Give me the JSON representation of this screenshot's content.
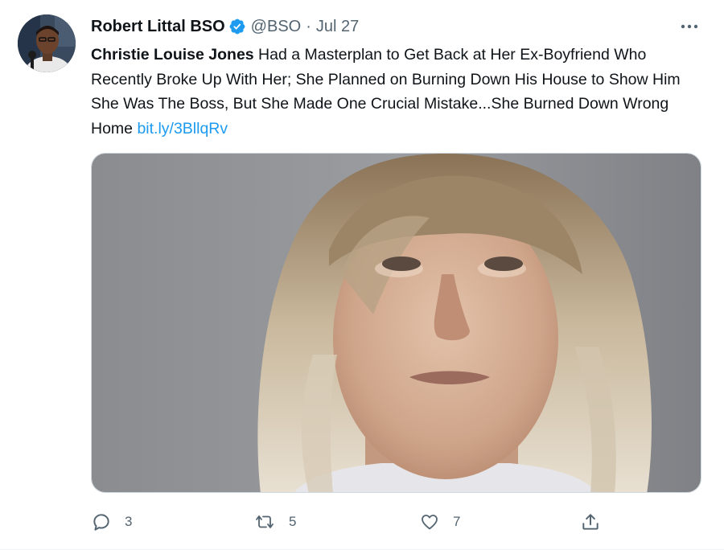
{
  "tweet": {
    "author": {
      "display_name": "Robert Littal BSO",
      "handle": "@BSO",
      "verified": true
    },
    "separator": "·",
    "timestamp": "Jul 27",
    "text": {
      "bold_lead": "Christie Louise Jones",
      "body": " Had a Masterplan to Get Back at Her Ex-Boyfriend Who Recently Broke Up With Her; She Planned on Burning Down His House to Show Him She Was The Boss, But She Made One Crucial Mistake...She Burned Down Wrong Home ",
      "link": "bit.ly/3BllqRv"
    },
    "actions": {
      "reply_count": "3",
      "retweet_count": "5",
      "like_count": "7"
    }
  },
  "icons": {
    "verified": "verified-badge-icon",
    "more": "more-icon",
    "reply": "reply-icon",
    "retweet": "retweet-icon",
    "like": "like-icon",
    "share": "share-icon"
  },
  "colors": {
    "text_primary": "#0f1419",
    "text_secondary": "#536471",
    "link": "#1d9bf0",
    "verified": "#1d9bf0"
  }
}
